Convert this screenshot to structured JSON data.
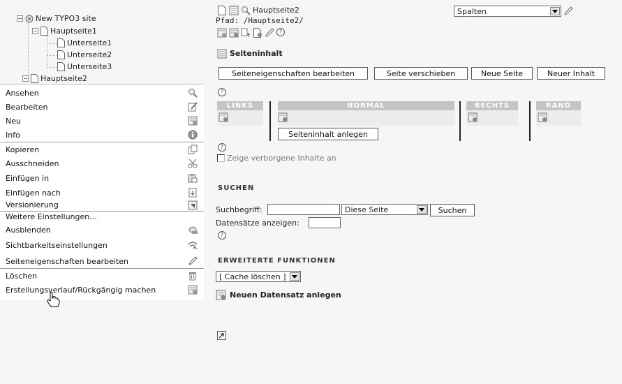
{
  "tree": {
    "root": "New TYPO3 site",
    "items": [
      {
        "label": "Hauptseite1"
      },
      {
        "label": "Unterseite1"
      },
      {
        "label": "Unterseite2"
      },
      {
        "label": "Unterseite3"
      },
      {
        "label": "Hauptseite2"
      }
    ]
  },
  "context_menu": {
    "items": [
      {
        "label": "Ansehen",
        "icon": "magnifier-icon"
      },
      {
        "label": "Bearbeiten",
        "icon": "pencil-page-icon"
      },
      {
        "label": "Neu",
        "icon": "new-record-icon"
      },
      {
        "label": "Info",
        "icon": "info-icon"
      },
      {
        "label": "Kopieren",
        "icon": "copy-icon"
      },
      {
        "label": "Ausschneiden",
        "icon": "scissors-icon"
      },
      {
        "label": "Einfügen in",
        "icon": "paste-into-icon"
      },
      {
        "label": "Einfügen nach",
        "icon": "paste-after-icon"
      },
      {
        "label": "Versionierung",
        "icon": "versioning-icon"
      },
      {
        "label": "Weitere Einstellungen...",
        "icon": ""
      },
      {
        "label": "Ausblenden",
        "icon": "hide-icon"
      },
      {
        "label": "Sichtbarkeitseinstellungen",
        "icon": "visibility-icon"
      },
      {
        "label": "Seiteneigenschaften bearbeiten",
        "icon": "edit-pencil-icon"
      },
      {
        "label": "Löschen",
        "icon": "trash-icon"
      },
      {
        "label": "Erstellungsverlauf/Rückgängig machen",
        "icon": "history-icon"
      }
    ]
  },
  "page_header": {
    "page_title": "Hauptseite2",
    "path": "Pfad: /Hauptseite2/",
    "view_select": "Spalten"
  },
  "section": {
    "title": "Seiteninhalt"
  },
  "action_buttons": {
    "edit_props": "Seiteneigenschaften bearbeiten",
    "move_page": "Seite verschieben",
    "new_page": "Neue Seite",
    "new_content": "Neuer Inhalt"
  },
  "columns": {
    "links": "LINKS",
    "normal": "NORMAL",
    "rechts": "RECHTS",
    "rand": "RAND",
    "create_content": "Seiteninhalt anlegen"
  },
  "hidden_toggle": "Zeige verborgene Inhalte an",
  "search": {
    "title": "SUCHEN",
    "term_label": "Suchbegriff:",
    "term_value": "",
    "scope_select": "Diese Seite",
    "button": "Suchen",
    "records_label": "Datensätze anzeigen:",
    "records_value": ""
  },
  "advanced": {
    "title": "ERWEITERTE FUNKTIONEN",
    "cache_select": "[ Cache löschen ]",
    "new_record": "Neuen Datensatz anlegen"
  },
  "colors": {
    "column_header": "#c4c4c4",
    "column_body": "#ececec",
    "background": "#f6f6f6"
  }
}
